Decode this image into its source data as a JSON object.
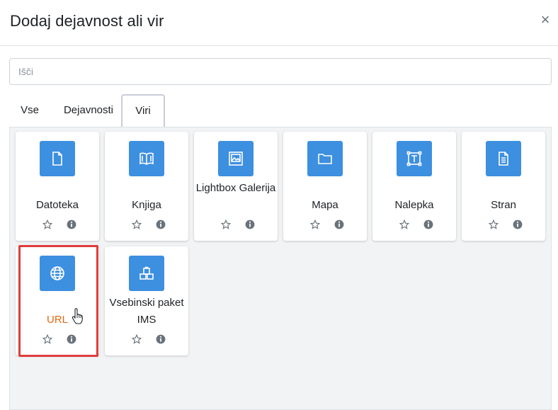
{
  "dialog": {
    "title": "Dodaj dejavnost ali vir"
  },
  "search": {
    "placeholder": "Išči"
  },
  "tabs": [
    {
      "label": "Vse"
    },
    {
      "label": "Dejavnosti"
    },
    {
      "label": "Viri",
      "active": true
    }
  ],
  "cards": [
    {
      "name": "Datoteka",
      "icon": "file-icon"
    },
    {
      "name": "Knjiga",
      "icon": "book-icon"
    },
    {
      "name": "Lightbox Galerija",
      "icon": "image-gallery-icon"
    },
    {
      "name": "Mapa",
      "icon": "folder-icon"
    },
    {
      "name": "Nalepka",
      "icon": "label-text-icon"
    },
    {
      "name": "Stran",
      "icon": "page-icon"
    },
    {
      "name": "URL",
      "icon": "globe-icon",
      "highlighted": true,
      "hovered": true
    },
    {
      "name": "Vsebinski paket IMS",
      "icon": "package-icon"
    }
  ],
  "colors": {
    "icon_bg": "#3d8fe0",
    "highlight": "#e03c3c",
    "hover_text": "#e06b14"
  }
}
